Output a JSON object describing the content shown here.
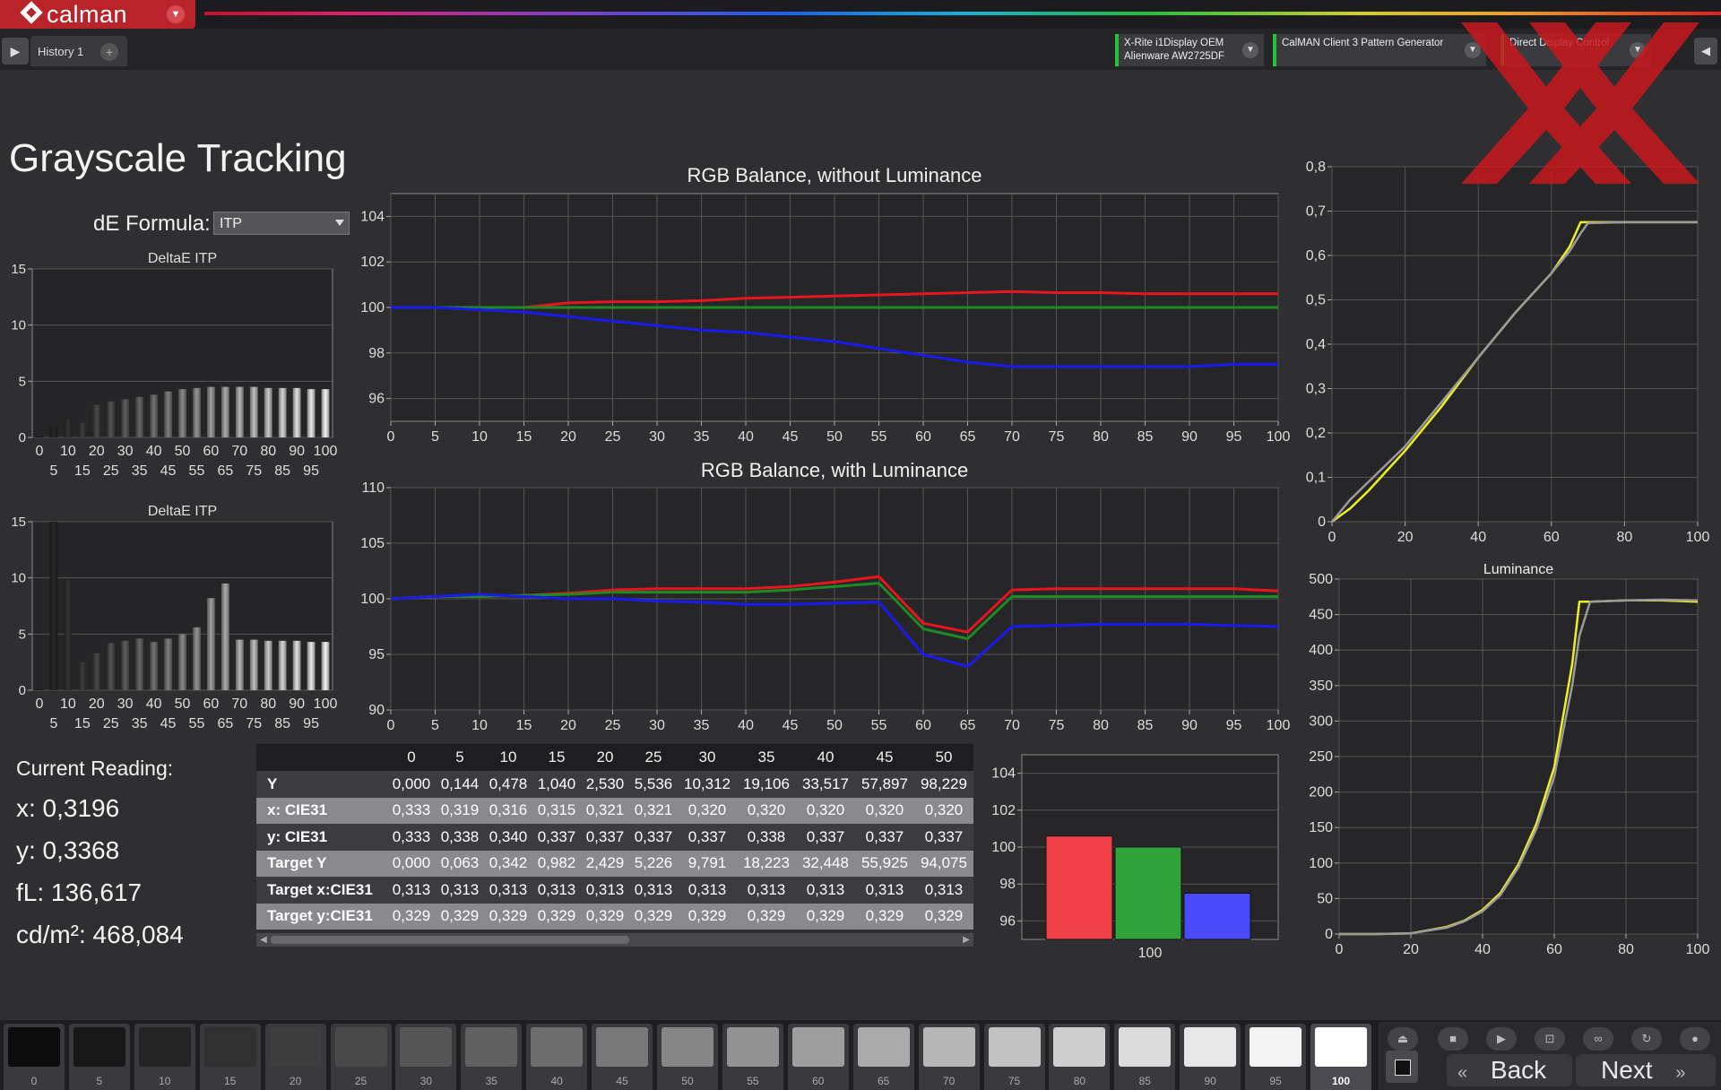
{
  "app": {
    "name": "calman",
    "tab": "History 1",
    "add_tab_icon": "+"
  },
  "devices": [
    {
      "line1": "X-Rite i1Display OEM",
      "line2": "Alienware AW2725DF",
      "status_color": "#23c83a"
    },
    {
      "line1": "CalMAN Client 3 Pattern Generator",
      "line2": "",
      "status_color": "#23c83a"
    },
    {
      "line1": "Direct Display Control",
      "line2": "",
      "status_color": "#23c83a"
    }
  ],
  "page": {
    "title": "Grayscale Tracking",
    "de_formula_label": "dE Formula:",
    "de_formula_value": "ITP"
  },
  "current_reading": {
    "title": "Current Reading:",
    "x": "x: 0,3196",
    "y": "y: 0,3368",
    "fl": "fL: 136,617",
    "cdm2": "cd/m²: 468,084"
  },
  "table": {
    "columns": [
      "",
      "0",
      "5",
      "10",
      "15",
      "20",
      "25",
      "30",
      "35",
      "40",
      "45",
      "50"
    ],
    "rows": [
      {
        "label": "Y",
        "values": [
          "0,000",
          "0,144",
          "0,478",
          "1,040",
          "2,530",
          "5,536",
          "10,312",
          "19,106",
          "33,517",
          "57,897",
          "98,229"
        ],
        "shade": "dark"
      },
      {
        "label": "x: CIE31",
        "values": [
          "0,333",
          "0,319",
          "0,316",
          "0,315",
          "0,321",
          "0,321",
          "0,320",
          "0,320",
          "0,320",
          "0,320",
          "0,320"
        ],
        "shade": "light"
      },
      {
        "label": "y: CIE31",
        "values": [
          "0,333",
          "0,338",
          "0,340",
          "0,337",
          "0,337",
          "0,337",
          "0,337",
          "0,338",
          "0,337",
          "0,337",
          "0,337"
        ],
        "shade": "dark"
      },
      {
        "label": "Target Y",
        "values": [
          "0,000",
          "0,063",
          "0,342",
          "0,982",
          "2,429",
          "5,226",
          "9,791",
          "18,223",
          "32,448",
          "55,925",
          "94,075"
        ],
        "shade": "light"
      },
      {
        "label": "Target x:CIE31",
        "values": [
          "0,313",
          "0,313",
          "0,313",
          "0,313",
          "0,313",
          "0,313",
          "0,313",
          "0,313",
          "0,313",
          "0,313",
          "0,313"
        ],
        "shade": "dark"
      },
      {
        "label": "Target y:CIE31",
        "values": [
          "0,329",
          "0,329",
          "0,329",
          "0,329",
          "0,329",
          "0,329",
          "0,329",
          "0,329",
          "0,329",
          "0,329",
          "0,329"
        ],
        "shade": "light"
      }
    ]
  },
  "swatches": [
    "0",
    "5",
    "10",
    "15",
    "20",
    "25",
    "30",
    "35",
    "40",
    "45",
    "50",
    "55",
    "60",
    "65",
    "70",
    "75",
    "80",
    "85",
    "90",
    "95",
    "100"
  ],
  "active_swatch": "100",
  "nav": {
    "back": "Back",
    "next": "Next"
  },
  "colors": {
    "red": "#e8141e",
    "green": "#1e8a24",
    "blue": "#1a1aee",
    "yellow": "#f0f020",
    "gray_ref": "#9a9a9a",
    "brand": "#b8242a"
  },
  "chart_data": [
    {
      "id": "deltae-top",
      "type": "bar",
      "title": "DeltaE ITP",
      "categories": [
        0,
        5,
        10,
        15,
        20,
        25,
        30,
        35,
        40,
        45,
        50,
        55,
        60,
        65,
        70,
        75,
        80,
        85,
        90,
        95,
        100
      ],
      "xticks_row1": [
        "0",
        "10",
        "20",
        "30",
        "40",
        "50",
        "60",
        "70",
        "80",
        "90",
        "100"
      ],
      "xticks_row2": [
        "5",
        "15",
        "25",
        "35",
        "45",
        "55",
        "65",
        "75",
        "85",
        "95"
      ],
      "yticks": [
        "0",
        "5",
        "10",
        "15"
      ],
      "ylim": [
        0,
        15
      ],
      "values": [
        0.1,
        1.0,
        1.6,
        1.3,
        2.9,
        3.2,
        3.4,
        3.6,
        3.8,
        4.1,
        4.3,
        4.4,
        4.5,
        4.5,
        4.5,
        4.5,
        4.4,
        4.4,
        4.4,
        4.3,
        4.3
      ]
    },
    {
      "id": "deltae-bottom",
      "type": "bar",
      "title": "DeltaE ITP",
      "categories": [
        0,
        5,
        10,
        15,
        20,
        25,
        30,
        35,
        40,
        45,
        50,
        55,
        60,
        65,
        70,
        75,
        80,
        85,
        90,
        95,
        100
      ],
      "xticks_row1": [
        "0",
        "10",
        "20",
        "30",
        "40",
        "50",
        "60",
        "70",
        "80",
        "90",
        "100"
      ],
      "xticks_row2": [
        "5",
        "15",
        "25",
        "35",
        "45",
        "55",
        "65",
        "75",
        "85",
        "95"
      ],
      "yticks": [
        "0",
        "5",
        "10",
        "15"
      ],
      "ylim": [
        0,
        15
      ],
      "values": [
        0.1,
        15.0,
        9.8,
        2.5,
        3.3,
        4.2,
        4.4,
        4.6,
        4.3,
        4.6,
        5.0,
        5.6,
        8.2,
        9.5,
        4.5,
        4.5,
        4.4,
        4.4,
        4.4,
        4.3,
        4.3
      ]
    },
    {
      "id": "rgb-without",
      "type": "line",
      "title": "RGB Balance, without Luminance",
      "x": [
        0,
        5,
        10,
        15,
        20,
        25,
        30,
        35,
        40,
        45,
        50,
        55,
        60,
        65,
        70,
        75,
        80,
        85,
        90,
        95,
        100
      ],
      "xticks": [
        "0",
        "5",
        "10",
        "15",
        "20",
        "25",
        "30",
        "35",
        "40",
        "45",
        "50",
        "55",
        "60",
        "65",
        "70",
        "75",
        "80",
        "85",
        "90",
        "95",
        "100"
      ],
      "yticks": [
        "96",
        "98",
        "100",
        "102",
        "104"
      ],
      "ylim": [
        95,
        105
      ],
      "series": [
        {
          "color": "#e8141e",
          "values": [
            100,
            100,
            100,
            100,
            100.2,
            100.25,
            100.25,
            100.3,
            100.4,
            100.45,
            100.5,
            100.55,
            100.6,
            100.65,
            100.7,
            100.65,
            100.65,
            100.6,
            100.6,
            100.6,
            100.6
          ]
        },
        {
          "color": "#1e8a24",
          "values": [
            100,
            100,
            100,
            100,
            100,
            100,
            100,
            100,
            100,
            100,
            100,
            100,
            100,
            100,
            100,
            100,
            100,
            100,
            100,
            100,
            100
          ]
        },
        {
          "color": "#1a1aee",
          "values": [
            100,
            100,
            99.9,
            99.8,
            99.6,
            99.4,
            99.2,
            99.0,
            98.9,
            98.7,
            98.5,
            98.2,
            97.9,
            97.6,
            97.4,
            97.4,
            97.4,
            97.4,
            97.4,
            97.5,
            97.5
          ]
        }
      ]
    },
    {
      "id": "rgb-with",
      "type": "line",
      "title": "RGB Balance, with Luminance",
      "x": [
        0,
        5,
        10,
        15,
        20,
        25,
        30,
        35,
        40,
        45,
        50,
        55,
        60,
        65,
        70,
        75,
        80,
        85,
        90,
        95,
        100
      ],
      "xticks": [
        "0",
        "5",
        "10",
        "15",
        "20",
        "25",
        "30",
        "35",
        "40",
        "45",
        "50",
        "55",
        "60",
        "65",
        "70",
        "75",
        "80",
        "85",
        "90",
        "95",
        "100"
      ],
      "yticks": [
        "90",
        "95",
        "100",
        "105",
        "110"
      ],
      "ylim": [
        90,
        110
      ],
      "series": [
        {
          "color": "#e8141e",
          "values": [
            100,
            100.2,
            100.2,
            100.3,
            100.5,
            100.8,
            100.9,
            100.9,
            100.9,
            101.1,
            101.5,
            102,
            97.8,
            97,
            100.8,
            100.9,
            100.9,
            100.9,
            100.9,
            100.9,
            100.7
          ]
        },
        {
          "color": "#1e8a24",
          "values": [
            100,
            100.2,
            100.2,
            100.3,
            100.4,
            100.6,
            100.6,
            100.6,
            100.6,
            100.8,
            101.1,
            101.4,
            97.3,
            96.4,
            100.2,
            100.2,
            100.2,
            100.2,
            100.2,
            100.2,
            100.2
          ]
        },
        {
          "color": "#1a1aee",
          "values": [
            100,
            100.2,
            100.4,
            100.2,
            100,
            100,
            99.8,
            99.7,
            99.5,
            99.5,
            99.6,
            99.7,
            95,
            93.9,
            97.5,
            97.6,
            97.7,
            97.7,
            97.7,
            97.6,
            97.5
          ]
        }
      ]
    },
    {
      "id": "rgb-bars",
      "type": "bar",
      "title": "",
      "categories": [
        "100"
      ],
      "yticks": [
        "96",
        "98",
        "100",
        "102",
        "104"
      ],
      "ylim": [
        95,
        105
      ],
      "series": [
        {
          "color": "#e8141e",
          "values": [
            100.6
          ]
        },
        {
          "color": "#1e8a24",
          "values": [
            100.0
          ]
        },
        {
          "color": "#1a1aee",
          "values": [
            97.5
          ]
        }
      ]
    },
    {
      "id": "eotf-top",
      "type": "line",
      "title": "",
      "x": [
        0,
        5,
        10,
        20,
        30,
        40,
        50,
        60,
        65,
        68,
        70,
        80,
        90,
        100
      ],
      "xticks": [
        "0",
        "20",
        "40",
        "60",
        "80",
        "100"
      ],
      "yticks": [
        "0",
        "0,1",
        "0,2",
        "0,3",
        "0,4",
        "0,5",
        "0,6",
        "0,7",
        "0,8"
      ],
      "ylim": [
        0,
        0.8
      ],
      "series": [
        {
          "color": "#f0f020",
          "values": [
            0,
            0.03,
            0.07,
            0.16,
            0.26,
            0.37,
            0.47,
            0.56,
            0.62,
            0.675,
            0.675,
            0.675,
            0.675,
            0.675
          ]
        },
        {
          "color": "#9a9a9a",
          "values": [
            0,
            0.05,
            0.09,
            0.17,
            0.27,
            0.37,
            0.47,
            0.56,
            0.61,
            0.65,
            0.673,
            0.675,
            0.675,
            0.675
          ]
        }
      ]
    },
    {
      "id": "luminance",
      "type": "line",
      "title": "Luminance",
      "x": [
        0,
        10,
        20,
        30,
        35,
        40,
        45,
        50,
        55,
        60,
        65,
        67,
        70,
        80,
        90,
        100
      ],
      "xticks": [
        "0",
        "20",
        "40",
        "60",
        "80",
        "100"
      ],
      "yticks": [
        "0",
        "50",
        "100",
        "150",
        "200",
        "250",
        "300",
        "350",
        "400",
        "450",
        "500"
      ],
      "ylim": [
        0,
        500
      ],
      "series": [
        {
          "color": "#f0f020",
          "values": [
            0,
            0,
            1,
            10,
            19,
            34,
            58,
            98,
            155,
            235,
            380,
            468,
            468,
            470,
            470,
            468
          ]
        },
        {
          "color": "#9a9a9a",
          "values": [
            0,
            0,
            1,
            9,
            18,
            32,
            55,
            94,
            148,
            222,
            350,
            420,
            468,
            470,
            471,
            470
          ]
        }
      ]
    }
  ]
}
